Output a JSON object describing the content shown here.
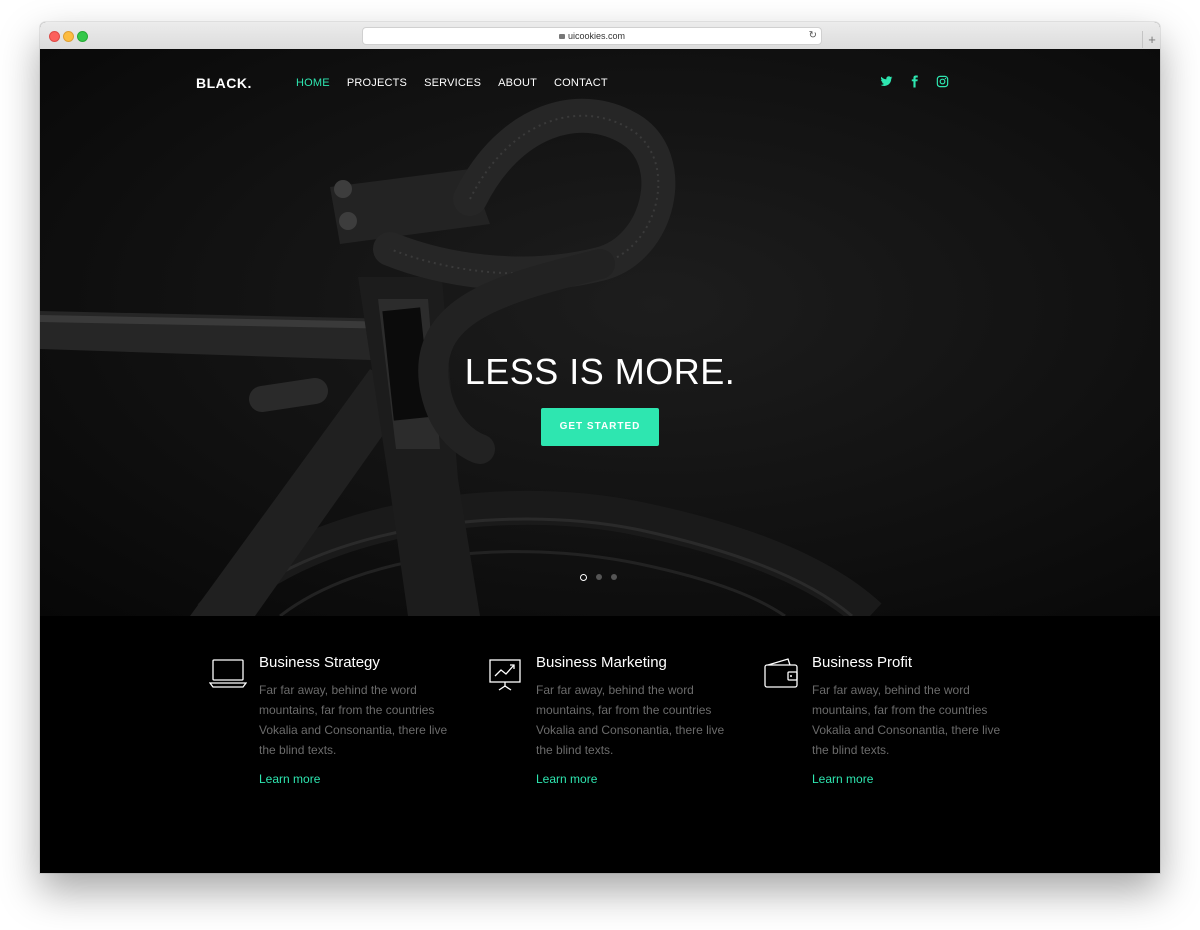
{
  "browser": {
    "url": "uicookies.com"
  },
  "site": {
    "brand": "BLACK.",
    "nav": [
      {
        "label": "HOME",
        "active": true
      },
      {
        "label": "PROJECTS",
        "active": false
      },
      {
        "label": "SERVICES",
        "active": false
      },
      {
        "label": "ABOUT",
        "active": false
      },
      {
        "label": "CONTACT",
        "active": false
      }
    ],
    "social": [
      "twitter-icon",
      "facebook-icon",
      "instagram-icon"
    ]
  },
  "hero": {
    "headline": "LESS IS MORE.",
    "cta_label": "GET STARTED",
    "slide_count": 3,
    "active_slide": 1
  },
  "features": [
    {
      "icon": "laptop-icon",
      "title": "Business Strategy",
      "text": "Far far away, behind the word mountains, far from the countries Vokalia and Consonantia, there live the blind texts.",
      "link": "Learn more"
    },
    {
      "icon": "presentation-chart-icon",
      "title": "Business Marketing",
      "text": "Far far away, behind the word mountains, far from the countries Vokalia and Consonantia, there live the blind texts.",
      "link": "Learn more"
    },
    {
      "icon": "wallet-icon",
      "title": "Business Profit",
      "text": "Far far away, behind the word mountains, far from the countries Vokalia and Consonantia, there live the blind texts.",
      "link": "Learn more"
    }
  ],
  "colors": {
    "accent": "#2ee6b0",
    "background": "#000000"
  }
}
